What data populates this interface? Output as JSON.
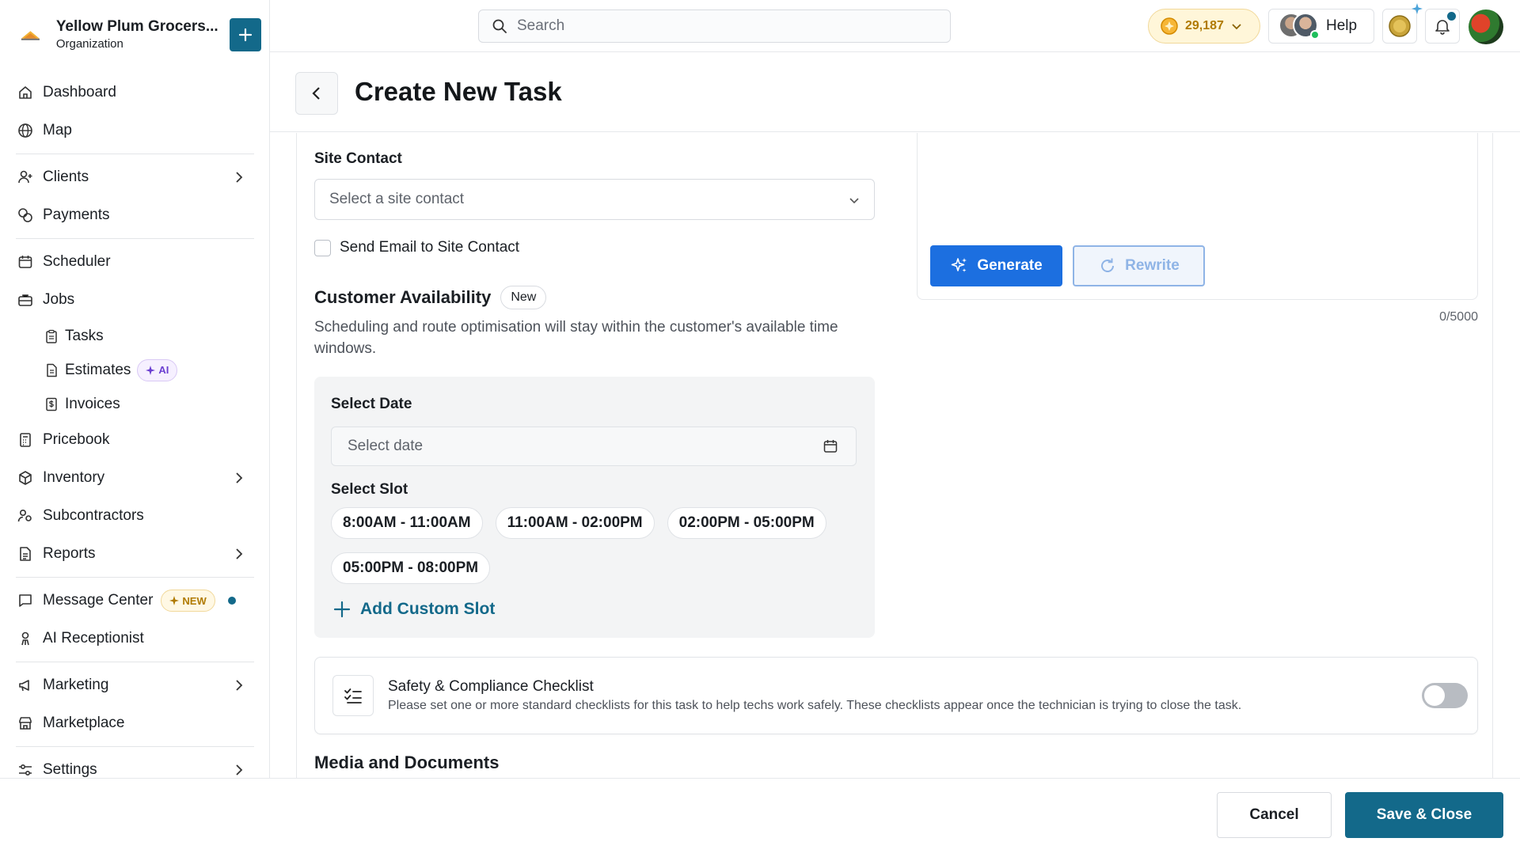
{
  "org": {
    "name": "Yellow Plum Grocers...",
    "type": "Organization"
  },
  "sidebar": {
    "items": [
      {
        "label": "Dashboard",
        "icon": "home-icon"
      },
      {
        "label": "Map",
        "icon": "globe-icon"
      },
      {
        "label": "Clients",
        "icon": "user-plus-icon"
      },
      {
        "label": "Payments",
        "icon": "coins-icon"
      },
      {
        "label": "Scheduler",
        "icon": "calendar-icon"
      },
      {
        "label": "Jobs",
        "icon": "briefcase-icon"
      },
      {
        "label": "Tasks",
        "icon": "clipboard-icon"
      },
      {
        "label": "Estimates",
        "icon": "file-icon",
        "badge": "AI"
      },
      {
        "label": "Invoices",
        "icon": "invoice-icon"
      },
      {
        "label": "Pricebook",
        "icon": "calculator-icon"
      },
      {
        "label": "Inventory",
        "icon": "box-icon"
      },
      {
        "label": "Subcontractors",
        "icon": "users-icon"
      },
      {
        "label": "Reports",
        "icon": "report-icon"
      },
      {
        "label": "Message Center",
        "icon": "message-icon",
        "badge": "NEW"
      },
      {
        "label": "AI Receptionist",
        "icon": "receptionist-icon"
      },
      {
        "label": "Marketing",
        "icon": "megaphone-icon"
      },
      {
        "label": "Marketplace",
        "icon": "store-icon"
      },
      {
        "label": "Settings",
        "icon": "sliders-icon"
      }
    ]
  },
  "topbar": {
    "search_placeholder": "Search",
    "coins": "29,187",
    "help_label": "Help"
  },
  "page": {
    "title": "Create New Task"
  },
  "form": {
    "site_contact_label": "Site Contact",
    "site_contact_placeholder": "Select a site contact",
    "send_email_label": "Send Email to Site Contact",
    "availability_title": "Customer Availability",
    "availability_badge": "New",
    "availability_desc": "Scheduling and route optimisation will stay within the customer's available time windows.",
    "select_date_label": "Select Date",
    "select_date_placeholder": "Select date",
    "select_slot_label": "Select Slot",
    "slots": [
      "8:00AM - 11:00AM",
      "11:00AM - 02:00PM",
      "02:00PM - 05:00PM",
      "05:00PM - 08:00PM"
    ],
    "add_custom_slot": "Add Custom Slot",
    "generate_label": "Generate",
    "rewrite_label": "Rewrite",
    "char_counter": "0/5000",
    "safety_title": "Safety & Compliance Checklist",
    "safety_desc": "Please set one or more standard checklists for this task to help techs work safely. These checklists appear once the technician is trying to close the task.",
    "media_title": "Media and Documents"
  },
  "footer": {
    "cancel_label": "Cancel",
    "save_label": "Save & Close"
  },
  "colors": {
    "primary": "#13698a",
    "ai_blue": "#1c6fe0",
    "coin_gold": "#b07a00"
  }
}
